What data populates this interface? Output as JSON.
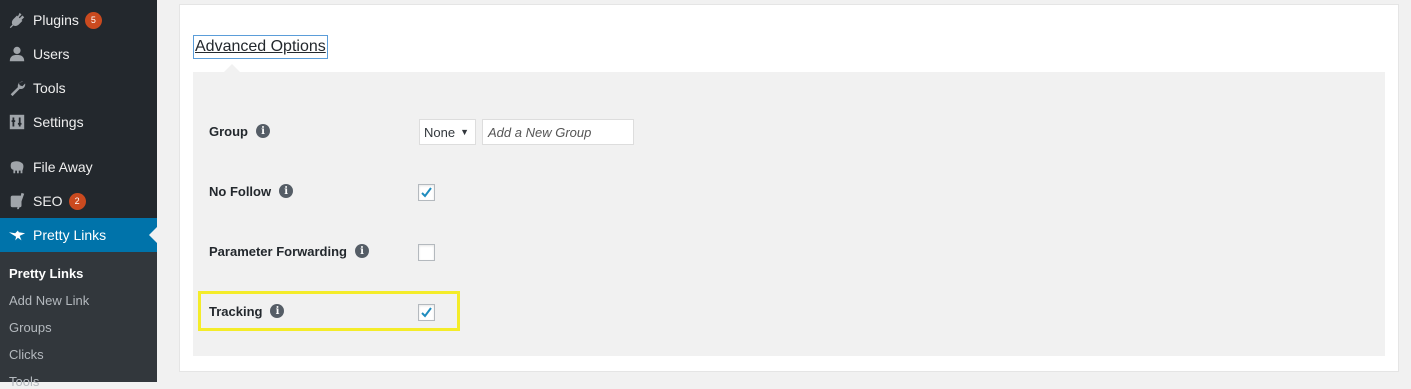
{
  "sidebar": {
    "items": [
      {
        "label": "Plugins",
        "icon": "plugin-icon",
        "badge": "5"
      },
      {
        "label": "Users",
        "icon": "user-icon",
        "badge": ""
      },
      {
        "label": "Tools",
        "icon": "wrench-icon",
        "badge": ""
      },
      {
        "label": "Settings",
        "icon": "settings-sliders-icon",
        "badge": ""
      },
      {
        "label": "File Away",
        "icon": "elephant-icon",
        "badge": ""
      },
      {
        "label": "SEO",
        "icon": "yoast-icon",
        "badge": "2"
      },
      {
        "label": "Pretty Links",
        "icon": "star-link-icon",
        "badge": ""
      }
    ],
    "submenu": [
      "Pretty Links",
      "Add New Link",
      "Groups",
      "Clicks",
      "Tools"
    ],
    "active_color": "#0073aa",
    "badge_color": "#ca4a1f"
  },
  "advanced": {
    "toggle_label": "Advanced Options",
    "group": {
      "label": "Group",
      "select_value": "None",
      "input_placeholder": "Add a New Group"
    },
    "no_follow": {
      "label": "No Follow",
      "checked": true
    },
    "parameter_forwarding": {
      "label": "Parameter Forwarding",
      "checked": false
    },
    "tracking": {
      "label": "Tracking",
      "checked": true
    },
    "highlight_color": "#f4ec29"
  }
}
